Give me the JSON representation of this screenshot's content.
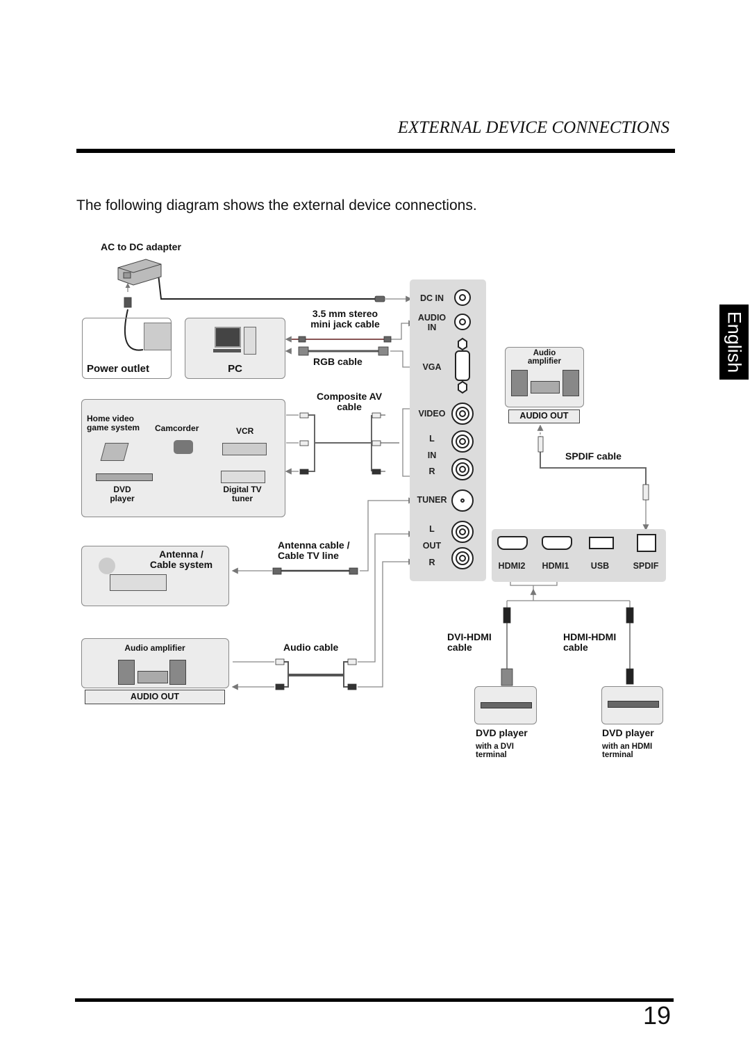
{
  "header": {
    "section_title": "EXTERNAL DEVICE CONNECTIONS"
  },
  "language_tab": "English",
  "intro": "The following diagram shows the external device connections.",
  "devices": {
    "ac_adapter": "AC to DC adapter",
    "power_outlet": "Power outlet",
    "pc": "PC",
    "av_group": {
      "game": "Home video\ngame system",
      "camcorder": "Camcorder",
      "vcr": "VCR",
      "dvd": "DVD\nplayer",
      "tuner": "Digital TV\ntuner"
    },
    "antenna": "Antenna /\nCable system",
    "audio_amp_left": "Audio amplifier",
    "audio_out_left": "AUDIO OUT",
    "audio_amp_right": "Audio\namplifier",
    "audio_out_right": "AUDIO OUT",
    "dvd_dvi": {
      "title": "DVD player",
      "sub": "with a DVI\nterminal"
    },
    "dvd_hdmi": {
      "title": "DVD player",
      "sub": "with an HDMI\nterminal"
    }
  },
  "cables": {
    "stereo": "3.5 mm stereo\nmini jack cable",
    "rgb": "RGB cable",
    "composite": "Composite AV\ncable",
    "antenna": "Antenna cable /\nCable TV line",
    "audio": "Audio cable",
    "spdif": "SPDIF cable",
    "dvi_hdmi": "DVI-HDMI\ncable",
    "hdmi_hdmi": "HDMI-HDMI\ncable"
  },
  "tv_panel": {
    "dc_in": "DC IN",
    "audio_in": "AUDIO\nIN",
    "vga": "VGA",
    "video": "VIDEO",
    "in_l": "L",
    "in": "IN",
    "in_r": "R",
    "tuner": "TUNER",
    "out_l": "L",
    "out": "OUT",
    "out_r": "R"
  },
  "side_panel": {
    "hdmi2": "HDMI2",
    "hdmi1": "HDMI1",
    "usb": "USB",
    "spdif": "SPDIF"
  },
  "page_number": "19"
}
